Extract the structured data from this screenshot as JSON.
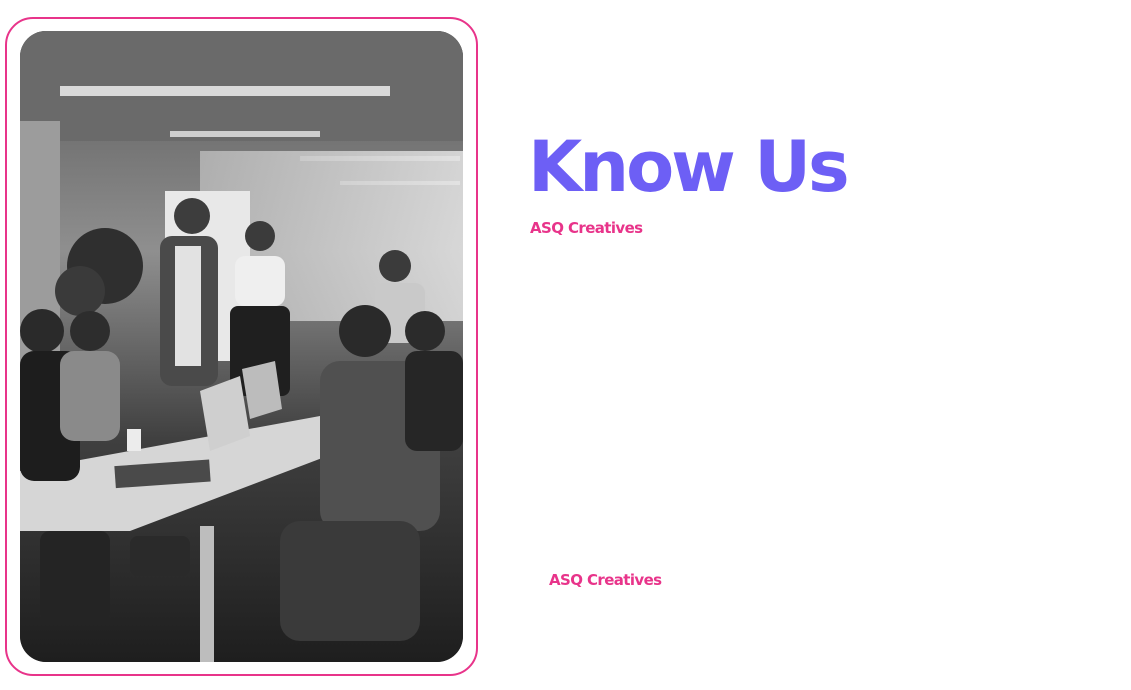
{
  "section": {
    "heading": "Know Us",
    "brand_label_top": "ASQ Creatives",
    "brand_label_bottom": "ASQ Creatives"
  },
  "photo": {
    "icon": "team-meeting-photo",
    "style": "grayscale"
  },
  "colors": {
    "heading": "#6d5ff5",
    "brand": "#e8348a",
    "frame_border": "#e8348a",
    "background": "#ffffff"
  }
}
